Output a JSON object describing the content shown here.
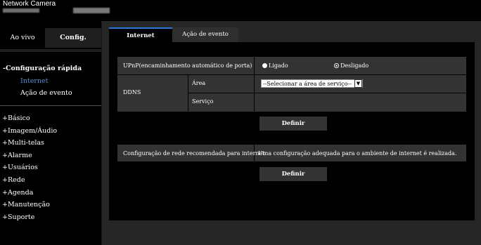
{
  "header": {
    "brand": "Network Camera"
  },
  "sidebar": {
    "tabs": {
      "live": "Ao vivo",
      "config": "Config."
    },
    "quick": {
      "title": "-Configuração rápida",
      "items": [
        "Internet",
        "Ação de evento"
      ]
    },
    "menu": [
      "+Básico",
      "+Imagem/Áudio",
      "+Multi-telas",
      "+Alarme",
      "+Usuários",
      "+Rede",
      "+Agenda",
      "+Manutenção",
      "+Suporte"
    ]
  },
  "main": {
    "tabs": [
      "Internet",
      "Ação de evento"
    ],
    "upnp": {
      "label": "UPnP(encaminhamento automático de porta)",
      "on": "Ligado",
      "off": "Desligado",
      "selected": "off"
    },
    "ddns": {
      "label": "DDNS",
      "area_label": "Área",
      "area_value": "--Selecionar a área de serviço--",
      "service_label": "Serviço"
    },
    "define1": "Definir",
    "recommended": {
      "label": "Configuração de rede recomendada para internet",
      "value": "Uma configuração adequada para o ambiente de internet é realizada."
    },
    "define2": "Definir"
  }
}
